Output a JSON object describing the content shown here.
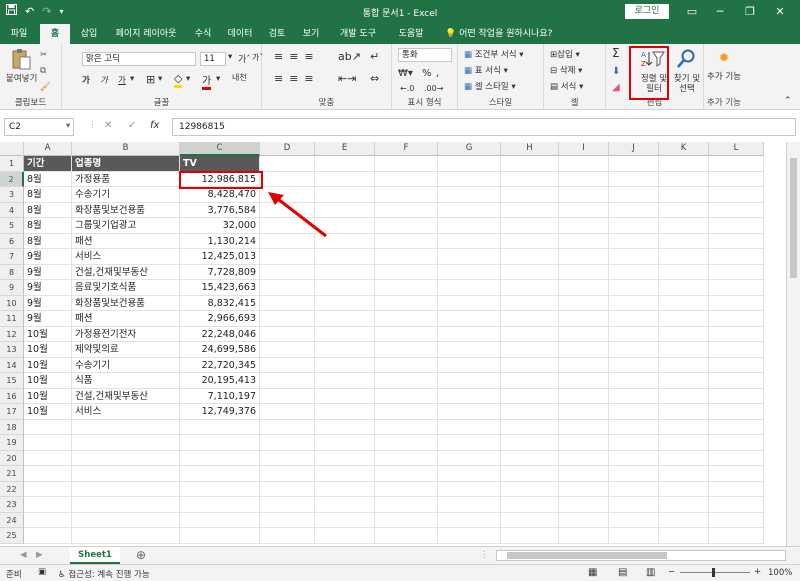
{
  "window": {
    "title": "통합 문서1 - Excel",
    "login_label": "로그인",
    "minimize": "─",
    "restore": "❐",
    "close": "✕"
  },
  "qat": {
    "save_icon": "save-icon",
    "undo": "↶",
    "redo": "↷"
  },
  "tabs": [
    {
      "label": "파일"
    },
    {
      "label": "홈"
    },
    {
      "label": "삽입"
    },
    {
      "label": "페이지 레이아웃"
    },
    {
      "label": "수식"
    },
    {
      "label": "데이터"
    },
    {
      "label": "검토"
    },
    {
      "label": "보기"
    },
    {
      "label": "개발 도구"
    },
    {
      "label": "도움말"
    }
  ],
  "tell_me": "어떤 작업을 원하시나요?",
  "ribbon": {
    "clipboard": {
      "paste": "붙여넣기",
      "label": "클립보드"
    },
    "font": {
      "name": "맑은 고딕",
      "size": "11",
      "bold": "가",
      "italic": "가",
      "underline": "가",
      "label": "글꼴"
    },
    "alignment": {
      "label": "맞춤"
    },
    "number": {
      "format": "통화",
      "percent": "%",
      "comma": ",",
      "label": "표시 형식"
    },
    "styles": {
      "conditional": "조건부 서식",
      "table": "표 서식",
      "cell_styles": "셀 스타일",
      "label": "스타일"
    },
    "cells": {
      "insert": "삽입",
      "delete": "삭제",
      "format": "서식",
      "label": "셀"
    },
    "editing": {
      "sort_filter": "정렬 및 필터",
      "find_select": "찾기 및 선택",
      "label": "편집"
    },
    "addins": {
      "addins": "추가 기능",
      "label": "추가 기능"
    }
  },
  "formula_bar": {
    "name_box": "C2",
    "cancel": "✕",
    "enter": "✓",
    "fx": "fx",
    "value": "12986815"
  },
  "columns": [
    "A",
    "B",
    "C",
    "D",
    "E",
    "F",
    "G",
    "H",
    "I",
    "J",
    "K",
    "L"
  ],
  "rows": [
    "1",
    "2",
    "3",
    "4",
    "5",
    "6",
    "7",
    "8",
    "9",
    "10",
    "11",
    "12",
    "13",
    "14",
    "15",
    "16",
    "17",
    "18",
    "19",
    "20",
    "21",
    "22",
    "23",
    "24",
    "25"
  ],
  "table": {
    "headers": [
      "기간",
      "업종명",
      "TV"
    ],
    "rows": [
      [
        "8월",
        "가정용품",
        "12,986,815"
      ],
      [
        "8월",
        "수송기기",
        "8,428,470"
      ],
      [
        "8월",
        "화장품및보건용품",
        "3,776,584"
      ],
      [
        "8월",
        "그룹및기업광고",
        "32,000"
      ],
      [
        "8월",
        "패션",
        "1,130,214"
      ],
      [
        "9월",
        "서비스",
        "12,425,013"
      ],
      [
        "9월",
        "건설,건재및부동산",
        "7,728,809"
      ],
      [
        "9월",
        "음료및기호식품",
        "15,423,663"
      ],
      [
        "9월",
        "화장품및보건용품",
        "8,832,415"
      ],
      [
        "9월",
        "패션",
        "2,966,693"
      ],
      [
        "10월",
        "가정용전기전자",
        "22,248,046"
      ],
      [
        "10월",
        "제약및의료",
        "24,699,586"
      ],
      [
        "10월",
        "수송기기",
        "22,720,345"
      ],
      [
        "10월",
        "식품",
        "20,195,413"
      ],
      [
        "10월",
        "건설,건재및부동산",
        "7,110,197"
      ],
      [
        "10월",
        "서비스",
        "12,749,376"
      ]
    ]
  },
  "sheet_tabs": [
    {
      "label": "Sheet1"
    }
  ],
  "status": {
    "ready": "준비",
    "accessibility": "접근성: 계속 진행 가능",
    "zoom": "100%"
  },
  "colors": {
    "excel_green": "#217346",
    "highlight_red": "#e00000",
    "header_fill": "#595959"
  }
}
